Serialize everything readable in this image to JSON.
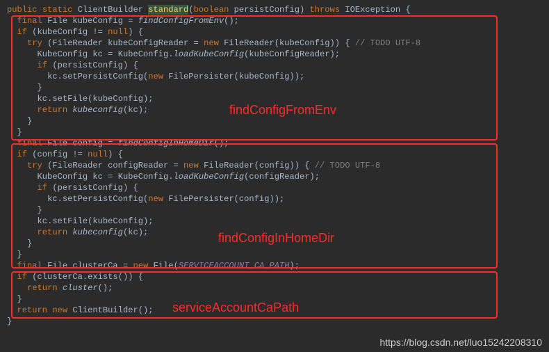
{
  "sig": {
    "kw_public": "public",
    "kw_static": "static",
    "ret_type": "ClientBuilder",
    "name": "standard",
    "param_kw": "boolean",
    "param_name": "persistConfig",
    "kw_throws": "throws",
    "exc": "IOException"
  },
  "b1": {
    "kw_final": "final",
    "type_file": "File",
    "var_kube": "kubeConfig",
    "fn_env": "findConfigFromEnv",
    "kw_if": "if",
    "kw_null": "null",
    "kw_try": "try",
    "type_fr": "FileReader",
    "var_reader": "kubeConfigReader",
    "kw_new": "new",
    "todo": "// TODO UTF-8",
    "type_kc": "KubeConfig",
    "var_kc": "kc",
    "fn_load": "loadKubeConfig",
    "cond_persist": "persistConfig",
    "fn_setpersist": "setPersistConfig",
    "type_fp": "FilePersister",
    "fn_setfile": "setFile",
    "kw_return": "return",
    "fn_kubeconfig": "kubeconfig"
  },
  "b2": {
    "kw_final": "final",
    "type_file": "File",
    "var_cfg": "config",
    "fn_home": "findConfigInHomeDir",
    "kw_if": "if",
    "kw_null": "null",
    "kw_try": "try",
    "type_fr": "FileReader",
    "var_reader": "configReader",
    "kw_new": "new",
    "todo": "// TODO UTF-8",
    "type_kc": "KubeConfig",
    "var_kc": "kc",
    "fn_load": "loadKubeConfig",
    "cond_persist": "persistConfig",
    "fn_setpersist": "setPersistConfig",
    "type_fp": "FilePersister",
    "fn_setfile": "setFile",
    "var_kube": "kubeConfig",
    "kw_return": "return",
    "fn_kubeconfig": "kubeconfig"
  },
  "b3": {
    "kw_final": "final",
    "type_file": "File",
    "var_ca": "clusterCa",
    "kw_new": "new",
    "const_path": "SERVICEACCOUNT_CA_PATH",
    "kw_if": "if",
    "fn_exists": "exists",
    "kw_return": "return",
    "fn_cluster": "cluster"
  },
  "tail": {
    "kw_return": "return",
    "kw_new": "new",
    "type_cb": "ClientBuilder"
  },
  "labels": {
    "l1": "findConfigFromEnv",
    "l2": "findConfigInHomeDir",
    "l3": "serviceAccountCaPath"
  },
  "watermark": "https://blog.csdn.net/luo15242208310"
}
